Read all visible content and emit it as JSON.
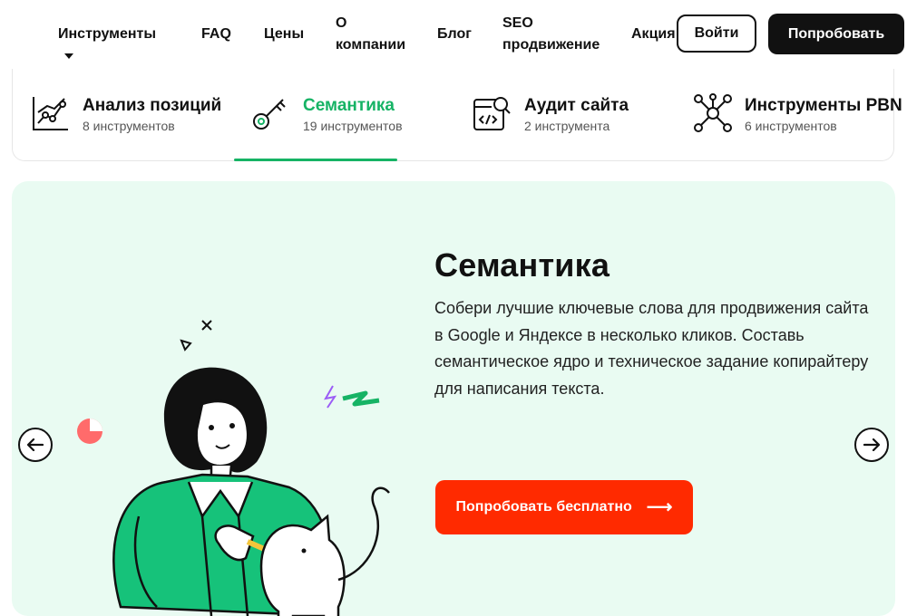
{
  "nav": {
    "tools": "Инструменты",
    "faq": "FAQ",
    "prices": "Цены",
    "company_line1": "О",
    "company_line2": "компании",
    "blog": "Блог",
    "seo_line1": "SEO",
    "seo_line2": "продвижение",
    "promo": "Акция",
    "login": "Войти",
    "try": "Попробовать"
  },
  "tabs": [
    {
      "title": "Анализ позиций",
      "subtitle": "8 инструментов",
      "icon": "chart-line-icon"
    },
    {
      "title": "Семантика",
      "subtitle": "19 инструментов",
      "icon": "key-icon"
    },
    {
      "title": "Аудит сайта",
      "subtitle": "2 инструмента",
      "icon": "code-search-icon"
    },
    {
      "title": "Инструменты PBN",
      "subtitle": "6 инструментов",
      "icon": "network-icon"
    }
  ],
  "colors": {
    "accent": "#16b365",
    "cta": "#ff2a00",
    "hero_bg": "#e9fbf2"
  },
  "hero": {
    "title": "Семантика",
    "text": "Собери лучшие ключевые слова для продвижения сайта в Google и Яндексе в несколько кликов. Составь семантическое ядро и техническое задание копирайтеру для написания текста.",
    "cta": "Попробовать бесплатно",
    "cta_arrow": "⟶"
  },
  "slider": {
    "prev_icon": "arrow-left-icon",
    "next_icon": "arrow-right-icon"
  }
}
